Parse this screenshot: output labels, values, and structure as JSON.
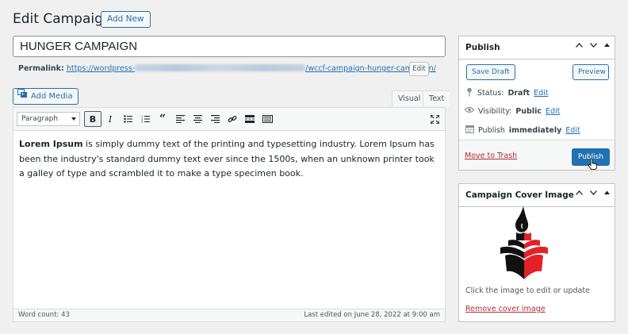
{
  "header": {
    "title": "Edit Campaign",
    "add_new": "Add New"
  },
  "post": {
    "title_value": "HUNGER CAMPAIGN",
    "permalink_label": "Permalink:",
    "permalink_prefix": "https://wordpress-",
    "permalink_suffix": "/wccf-campaign-hunger-campaign/",
    "permalink_edit": "Edit"
  },
  "editor": {
    "add_media": "Add Media",
    "tabs": [
      "Visual",
      "Text"
    ],
    "format_select": "Paragraph",
    "toolbar_icons": [
      "bold-icon",
      "italic-icon",
      "bulleted-list-icon",
      "numbered-list-icon",
      "blockquote-icon",
      "align-left-icon",
      "align-center-icon",
      "align-right-icon",
      "link-icon",
      "read-more-icon",
      "toolbar-toggle-icon",
      "fullscreen-icon"
    ],
    "content_bold": "Lorem Ipsum",
    "content_text": " is simply dummy text of the printing and typesetting industry. Lorem Ipsum has been the industry's standard dummy text ever since the 1500s, when an unknown printer took a galley of type and scrambled it to make a type specimen book.",
    "word_count": "Word count: 43",
    "last_edited": "Last edited on June 28, 2022 at 9:00 am"
  },
  "publish_box": {
    "title": "Publish",
    "save_draft": "Save Draft",
    "preview": "Preview",
    "status_label": "Status:",
    "status_value": "Draft",
    "visibility_label": "Visibility:",
    "visibility_value": "Public",
    "publish_label": "Publish",
    "publish_value": "immediately",
    "edit_link": "Edit",
    "move_to_trash": "Move to Trash",
    "publish_button": "Publish"
  },
  "cover_box": {
    "title": "Campaign Cover Image",
    "hint": "Click the image to edit or update",
    "remove": "Remove cover image"
  },
  "colors": {
    "accent": "#2271b1",
    "danger": "#b32d2e",
    "logo_red": "#e32228",
    "logo_black": "#111111"
  }
}
